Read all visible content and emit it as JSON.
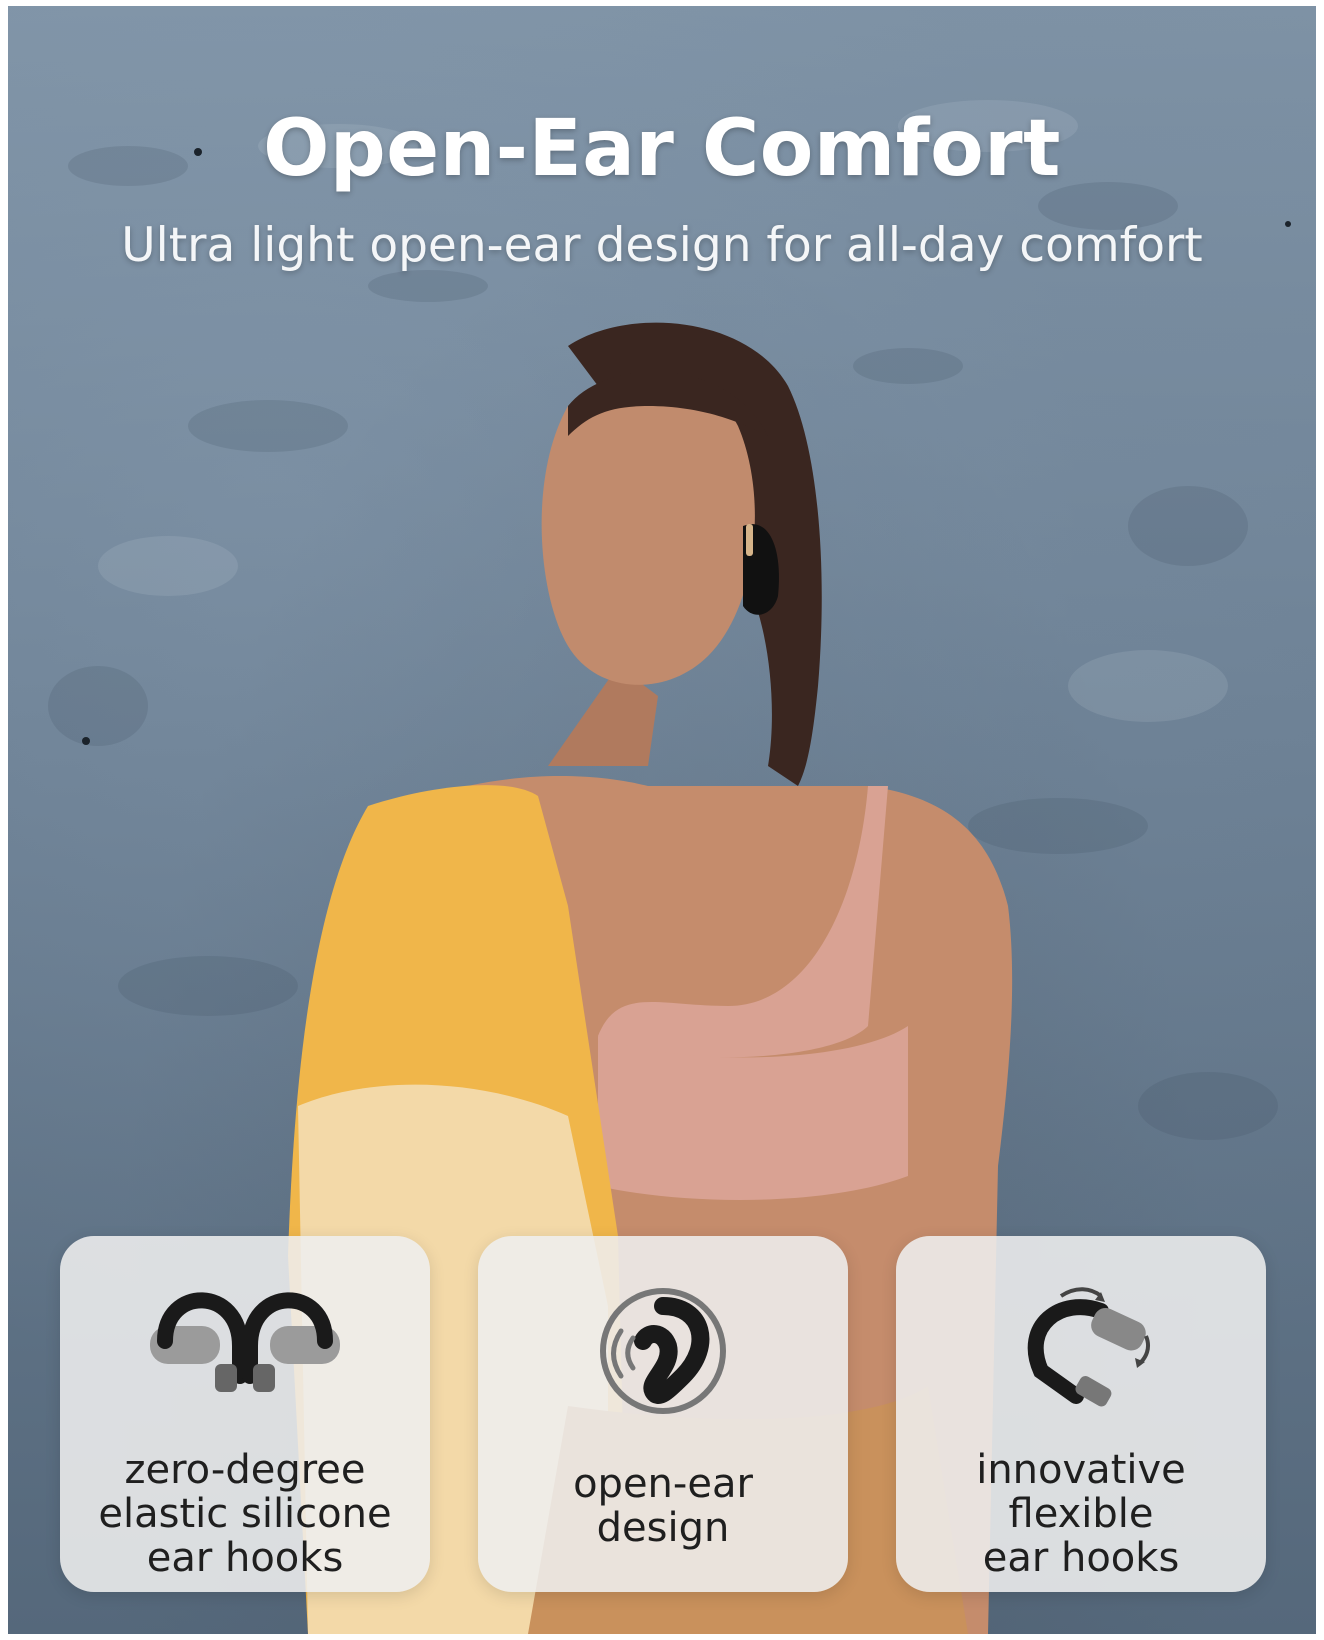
{
  "headline": "Open-Ear Comfort",
  "subheadline": "Ultra light open-ear design for all-day comfort",
  "features": [
    {
      "icon": "silicone-ear-hooks-icon",
      "label": "zero-degree\nelastic silicone\near hooks"
    },
    {
      "icon": "open-ear-sound-icon",
      "label": "open-ear\ndesign"
    },
    {
      "icon": "flexible-ear-hook-icon",
      "label": "innovative\nflexible\near hooks"
    }
  ],
  "colors": {
    "wall": "#6b7f93",
    "jacket": "#f0b64a",
    "top": "#d9a293",
    "card": "#eeeeee"
  }
}
